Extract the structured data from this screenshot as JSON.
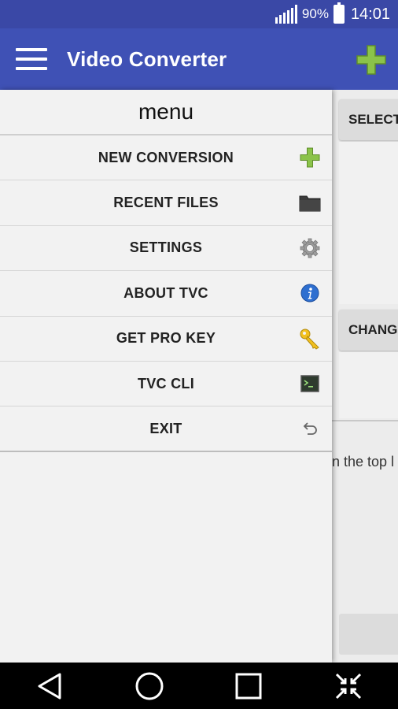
{
  "status_bar": {
    "battery_percent": "90%",
    "time": "14:01"
  },
  "app_bar": {
    "title": "Video Converter",
    "menu_icon": "hamburger-icon",
    "action_icon": "plus-icon"
  },
  "drawer": {
    "title": "menu",
    "items": [
      {
        "label": "NEW CONVERSION",
        "icon": "plus-icon"
      },
      {
        "label": "RECENT FILES",
        "icon": "folder-icon"
      },
      {
        "label": "SETTINGS",
        "icon": "gear-icon"
      },
      {
        "label": "ABOUT TVC",
        "icon": "info-icon"
      },
      {
        "label": "GET PRO KEY",
        "icon": "key-icon"
      },
      {
        "label": "TVC CLI",
        "icon": "terminal-icon"
      },
      {
        "label": "EXIT",
        "icon": "back-arrow-icon"
      }
    ]
  },
  "main": {
    "select_button_label": "SELECT",
    "change_button_label": "CHANG",
    "hint_text": "n the top l"
  },
  "colors": {
    "status_bar": "#3a48a6",
    "app_bar": "#3f51b5",
    "accent_green": "#8bc34a"
  }
}
